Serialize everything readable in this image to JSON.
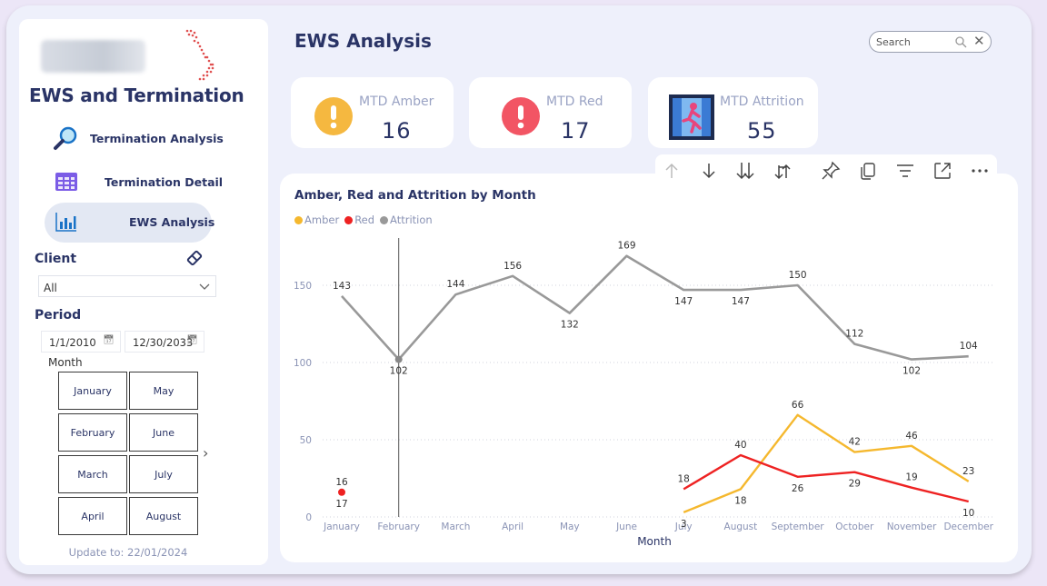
{
  "sidebar": {
    "title": "EWS and Termination",
    "nav": [
      {
        "label": "Termination Analysis",
        "icon": "magnifier-icon"
      },
      {
        "label": "Termination Detail",
        "icon": "table-icon"
      },
      {
        "label": "EWS Analysis",
        "icon": "bar-chart-icon",
        "active": true
      }
    ],
    "client_label": "Client",
    "client_value": "All",
    "period_label": "Period",
    "date_from": "1/1/2010",
    "date_to": "12/30/2033",
    "month_label": "Month",
    "months": [
      "January",
      "May",
      "February",
      "June",
      "March",
      "July",
      "April",
      "August"
    ],
    "update_text": "Update to: 22/01/2024"
  },
  "header": {
    "title": "EWS Analysis",
    "search_placeholder": "Search"
  },
  "cards": [
    {
      "title": "MTD Amber",
      "value": "16",
      "color": "#f5b840"
    },
    {
      "title": "MTD Red",
      "value": "17",
      "color": "#f25564"
    },
    {
      "title": "MTD Attrition",
      "value": "55",
      "color": "#3b7bd4"
    }
  ],
  "chart_data": {
    "type": "line",
    "title": "Amber, Red and Attrition by Month",
    "xlabel": "Month",
    "ylabel": "",
    "ylim": [
      0,
      175
    ],
    "yticks": [
      0,
      50,
      100,
      150
    ],
    "legend_position": "top-left",
    "categories": [
      "January",
      "February",
      "March",
      "April",
      "May",
      "June",
      "July",
      "August",
      "September",
      "October",
      "November",
      "December"
    ],
    "series": [
      {
        "name": "Amber",
        "color": "#f5b82e",
        "values": [
          null,
          null,
          null,
          null,
          null,
          null,
          3,
          18,
          66,
          42,
          46,
          23
        ]
      },
      {
        "name": "Red",
        "color": "#ee2222",
        "values": [
          16,
          null,
          null,
          null,
          null,
          null,
          18,
          40,
          26,
          29,
          19,
          10
        ]
      },
      {
        "name": "Attrition",
        "color": "#999999",
        "values": [
          143,
          102,
          144,
          156,
          132,
          169,
          147,
          147,
          150,
          112,
          102,
          104
        ]
      }
    ],
    "point_labels": [
      {
        "month": "January",
        "text": "16"
      },
      {
        "month": "January",
        "text": "17"
      },
      {
        "month": "February",
        "text": "102"
      }
    ]
  }
}
